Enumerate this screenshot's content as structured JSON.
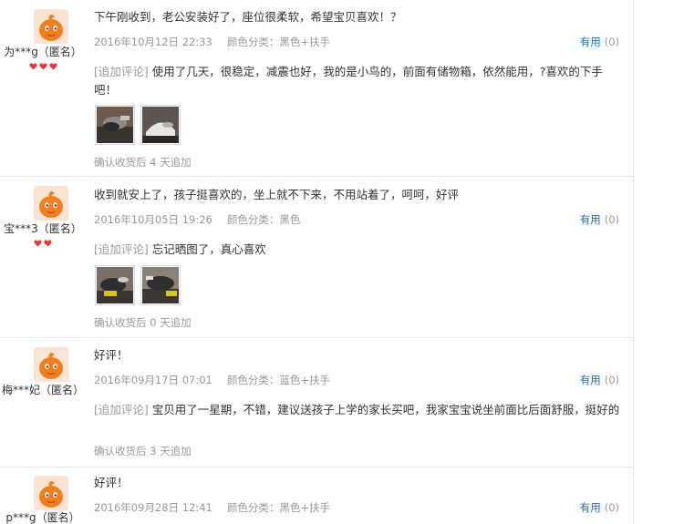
{
  "reviews": [
    {
      "user": "为***g（匿名）",
      "hearts": 3,
      "content": "下午刚收到，老公安装好了，座位很柔软，希望宝贝喜欢！？",
      "date": "2016年10月12日 22:33",
      "sku": "颜色分类：黑色+扶手",
      "useful_label": "有用",
      "useful_count": "(0)",
      "append_tag": "[追加评论]",
      "append_text": "使用了几天，很稳定，减震也好，我的是小鸟的，前面有储物箱，依然能用，?喜欢的下手吧！",
      "append_after": "确认收货后 4 天追加",
      "thumb_count": 2
    },
    {
      "user": "宝***3（匿名）",
      "hearts": 2,
      "content": "收到就安上了，孩子挺喜欢的，坐上就不下来，不用站着了，呵呵，好评",
      "date": "2016年10月05日 19:26",
      "sku": "颜色分类：黑色",
      "useful_label": "有用",
      "useful_count": "(0)",
      "append_tag": "[追加评论]",
      "append_text": "忘记晒图了，真心喜欢",
      "append_after": "确认收货后 0 天追加",
      "thumb_count": 2
    },
    {
      "user": "梅***妃（匿名）",
      "hearts": 0,
      "content": "好评！",
      "date": "2016年09月17日 07:01",
      "sku": "颜色分类：蓝色+扶手",
      "useful_label": "有用",
      "useful_count": "(0)",
      "append_tag": "[追加评论]",
      "append_text": "宝贝用了一星期，不错，建议送孩子上学的家长买吧，我家宝宝说坐前面比后面舒服，挺好的",
      "append_after": "确认收货后 3 天追加",
      "thumb_count": 0
    },
    {
      "user": "p***g（匿名）",
      "hearts": 0,
      "content": "好评！",
      "date": "2016年09月28日 12:41",
      "sku": "颜色分类：黑色+扶手",
      "useful_label": "有用",
      "useful_count": "(0)",
      "thumb_count": 0
    }
  ],
  "colors": {
    "useful_link": "#1a6fc5",
    "muted": "#999999",
    "heart": "#e4393c",
    "avatar": "#f0801f"
  }
}
